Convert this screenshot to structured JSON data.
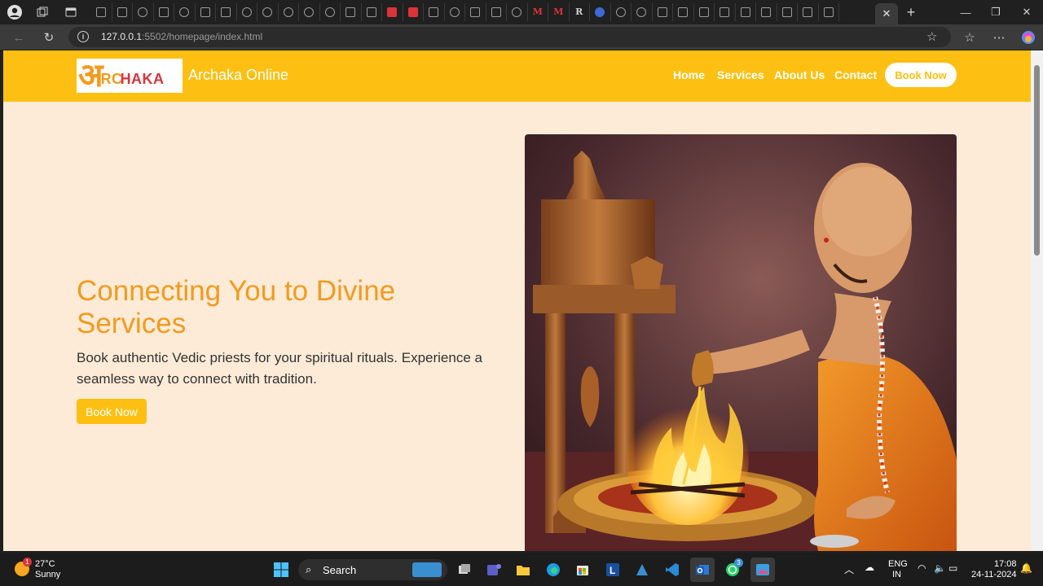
{
  "browser": {
    "url_host": "127.0.0.1",
    "url_path": ":5502/homepage/index.html",
    "mini_tab_favicons": [
      "sq",
      "sq",
      "round",
      "sq",
      "round",
      "sq",
      "sq",
      "round",
      "round",
      "round",
      "round",
      "round",
      "sq",
      "sq",
      "red",
      "red",
      "sq",
      "round",
      "sq",
      "sq",
      "round",
      "M",
      "M",
      "R",
      "blue",
      "round",
      "round",
      "sq",
      "sq",
      "sq",
      "sq",
      "sq",
      "sq",
      "sq",
      "sq",
      "sq"
    ]
  },
  "site": {
    "logo_big": "अ",
    "logo_word_1": "RC",
    "logo_word_2": "HAKA",
    "brand": "Archaka Online",
    "nav": [
      "Home",
      "Services",
      "About Us",
      "Contact"
    ],
    "header_button": "Book Now",
    "hero_title": "Connecting You to Divine Services",
    "hero_subtitle": "Book authentic Vedic priests for your spiritual rituals. Experience a seamless way to connect with tradition.",
    "hero_button": "Book Now",
    "colors": {
      "accent": "#fdc012",
      "title": "#f39a1e",
      "background": "#fdebd7"
    }
  },
  "taskbar": {
    "weather_badge": "1",
    "temperature": "27°C",
    "condition": "Sunny",
    "search_label": "Search",
    "whatsapp_badge": "3",
    "lang_1": "ENG",
    "lang_2": "IN",
    "time": "17:08",
    "date": "24-11-2024"
  }
}
